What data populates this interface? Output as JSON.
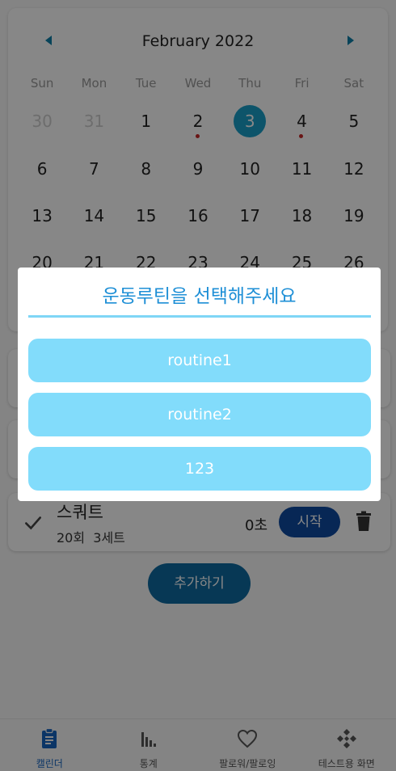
{
  "calendar": {
    "month_label": "February 2022",
    "weekdays": [
      "Sun",
      "Mon",
      "Tue",
      "Wed",
      "Thu",
      "Fri",
      "Sat"
    ],
    "weeks": [
      [
        "30",
        "31",
        "1",
        "2",
        "3",
        "4",
        "5"
      ],
      [
        "6",
        "7",
        "8",
        "9",
        "10",
        "11",
        "12"
      ],
      [
        "13",
        "14",
        "15",
        "16",
        "17",
        "18",
        "19"
      ],
      [
        "20",
        "21",
        "22",
        "23",
        "24",
        "25",
        "26"
      ]
    ],
    "selected_day": "3",
    "event_dot_days": [
      "2",
      "4"
    ]
  },
  "exercise": {
    "name": "스쿼트",
    "reps": "20회",
    "sets": "3세트",
    "time": "0초",
    "start_label": "시작"
  },
  "add_button_label": "추가하기",
  "bottom_nav": {
    "items": [
      {
        "label": "캘린더",
        "icon": "clipboard-icon",
        "active": true
      },
      {
        "label": "통계",
        "icon": "bar-chart-icon",
        "active": false
      },
      {
        "label": "팔로워/팔로잉",
        "icon": "heart-icon",
        "active": false
      },
      {
        "label": "테스트용 화면",
        "icon": "diamond-grid-icon",
        "active": false
      }
    ]
  },
  "dialog": {
    "title": "운동루틴을 선택해주세요",
    "options": [
      "routine1",
      "routine2",
      "123"
    ]
  },
  "colors": {
    "accent": "#1e8fd6",
    "routine_button": "#82dcfb",
    "selected_day": "#1a9fc9",
    "start_button": "#0e4aa0"
  }
}
